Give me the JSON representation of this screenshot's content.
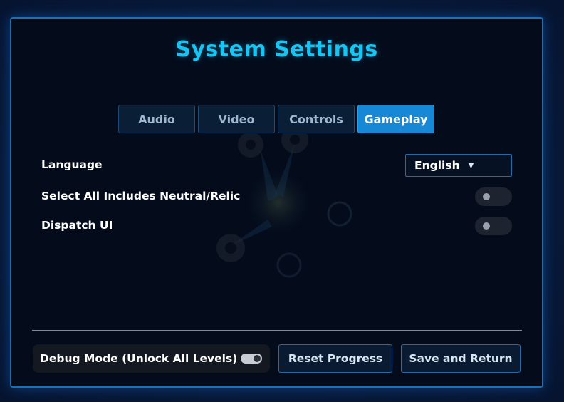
{
  "title": "System Settings",
  "tabs": [
    {
      "label": "Audio",
      "active": false
    },
    {
      "label": "Video",
      "active": false
    },
    {
      "label": "Controls",
      "active": false
    },
    {
      "label": "Gameplay",
      "active": true
    }
  ],
  "settings": {
    "language": {
      "label": "Language",
      "value": "English",
      "caret": "▼"
    },
    "select_all": {
      "label": "Select All Includes Neutral/Relic",
      "enabled": false
    },
    "dispatch_ui": {
      "label": "Dispatch UI",
      "enabled": false
    }
  },
  "footer": {
    "debug": {
      "label": "Debug Mode (Unlock All Levels)",
      "enabled": true
    },
    "reset_label": "Reset Progress",
    "save_label": "Save and Return"
  },
  "colors": {
    "accent": "#19c3f2",
    "active_tab": "#1688d6",
    "border": "#1a6fb5",
    "panel_bg": "#040c1c"
  }
}
